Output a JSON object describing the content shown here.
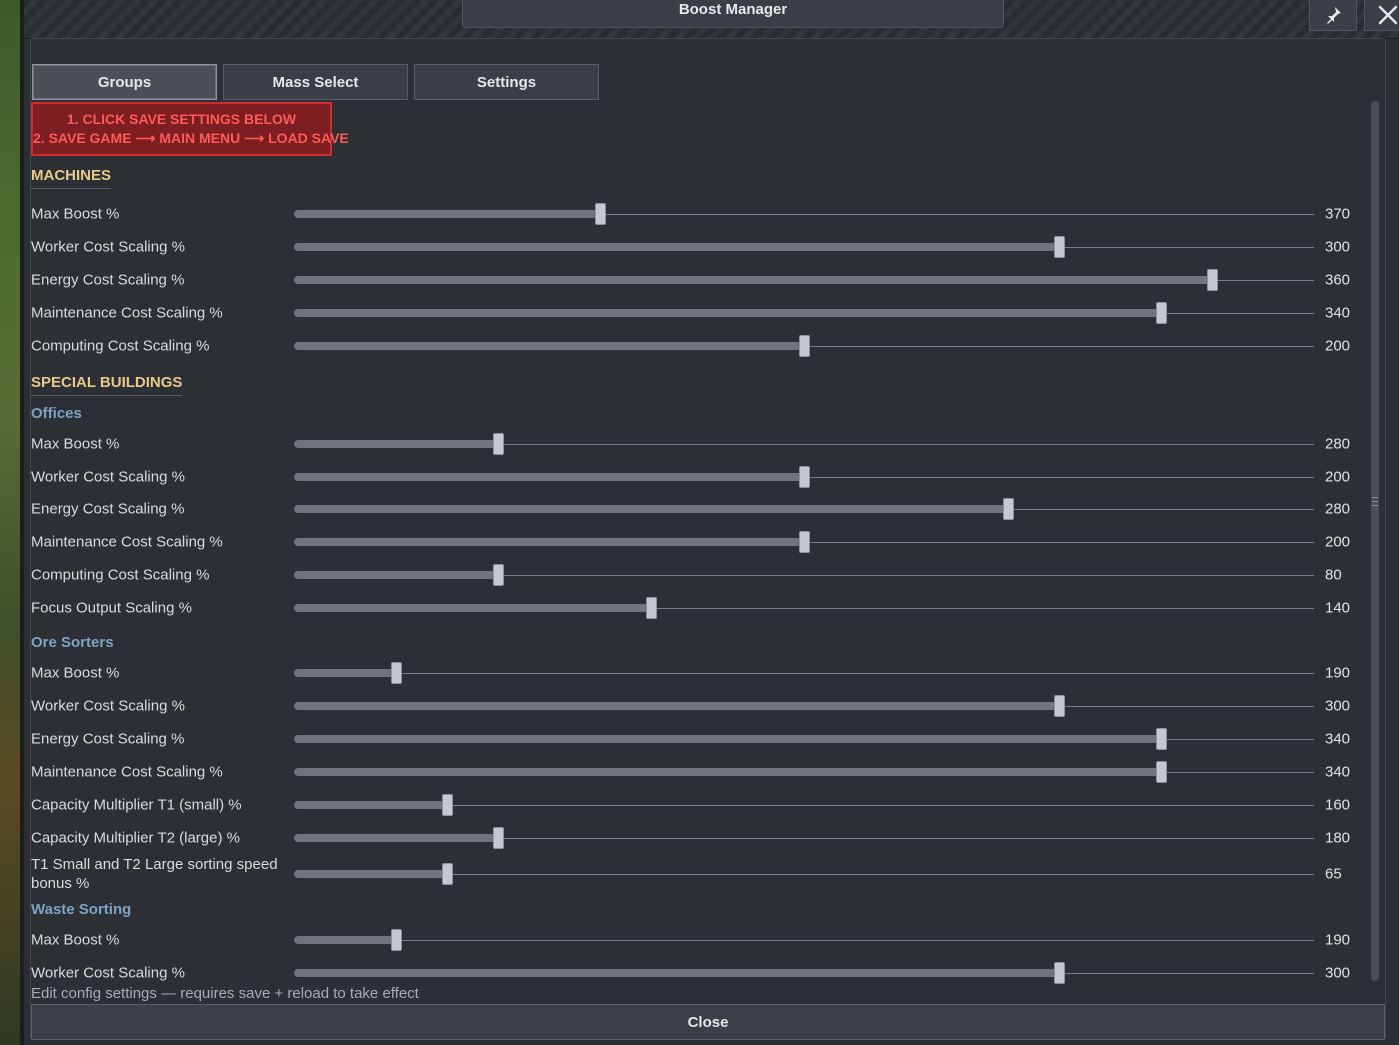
{
  "window": {
    "title": "Boost Manager"
  },
  "tabs": [
    {
      "label": "Groups",
      "active": true
    },
    {
      "label": "Mass Select",
      "active": false
    },
    {
      "label": "Settings",
      "active": false
    }
  ],
  "warning": {
    "line1": "1. CLICK SAVE SETTINGS BELOW",
    "line2": "2. SAVE GAME ⟶ MAIN MENU ⟶ LOAD SAVE"
  },
  "sections": {
    "machines": "MACHINES",
    "special": "SPECIAL BUILDINGS",
    "offices": "Offices",
    "ore_sorters": "Ore Sorters",
    "waste_sorting": "Waste Sorting"
  },
  "sliders": [
    {
      "label": "Max Boost %",
      "value": "370",
      "fraction": 0.3
    },
    {
      "label": "Worker Cost Scaling %",
      "value": "300",
      "fraction": 0.75
    },
    {
      "label": "Energy Cost Scaling %",
      "value": "360",
      "fraction": 0.9
    },
    {
      "label": "Maintenance Cost Scaling %",
      "value": "340",
      "fraction": 0.85
    },
    {
      "label": "Computing Cost Scaling %",
      "value": "200",
      "fraction": 0.5
    },
    {
      "label": "Max Boost %",
      "value": "280",
      "fraction": 0.2
    },
    {
      "label": "Worker Cost Scaling %",
      "value": "200",
      "fraction": 0.5
    },
    {
      "label": "Energy Cost Scaling %",
      "value": "280",
      "fraction": 0.7
    },
    {
      "label": "Maintenance Cost Scaling %",
      "value": "200",
      "fraction": 0.5
    },
    {
      "label": "Computing Cost Scaling %",
      "value": "80",
      "fraction": 0.2
    },
    {
      "label": "Focus Output Scaling %",
      "value": "140",
      "fraction": 0.35
    },
    {
      "label": "Max Boost %",
      "value": "190",
      "fraction": 0.1
    },
    {
      "label": "Worker Cost Scaling %",
      "value": "300",
      "fraction": 0.75
    },
    {
      "label": "Energy Cost Scaling %",
      "value": "340",
      "fraction": 0.85
    },
    {
      "label": "Maintenance Cost Scaling %",
      "value": "340",
      "fraction": 0.85
    },
    {
      "label": "Capacity Multiplier T1 (small) %",
      "value": "160",
      "fraction": 0.15
    },
    {
      "label": "Capacity Multiplier T2 (large) %",
      "value": "180",
      "fraction": 0.2
    },
    {
      "label": "T1 Small and T2 Large sorting speed bonus %",
      "value": "65",
      "fraction": 0.15
    },
    {
      "label": "Max Boost %",
      "value": "190",
      "fraction": 0.1
    },
    {
      "label": "Worker Cost Scaling %",
      "value": "300",
      "fraction": 0.75
    }
  ],
  "footer_note": "Edit config settings — requires save + reload to take effect",
  "close_label": "Close",
  "icons": {
    "pin": "pin-icon",
    "close": "close-icon"
  },
  "colors": {
    "section": "#e7c98b",
    "subsection": "#7fa3c6",
    "warning_bg": "#7d1e22",
    "warning_text": "#ff5a58"
  }
}
